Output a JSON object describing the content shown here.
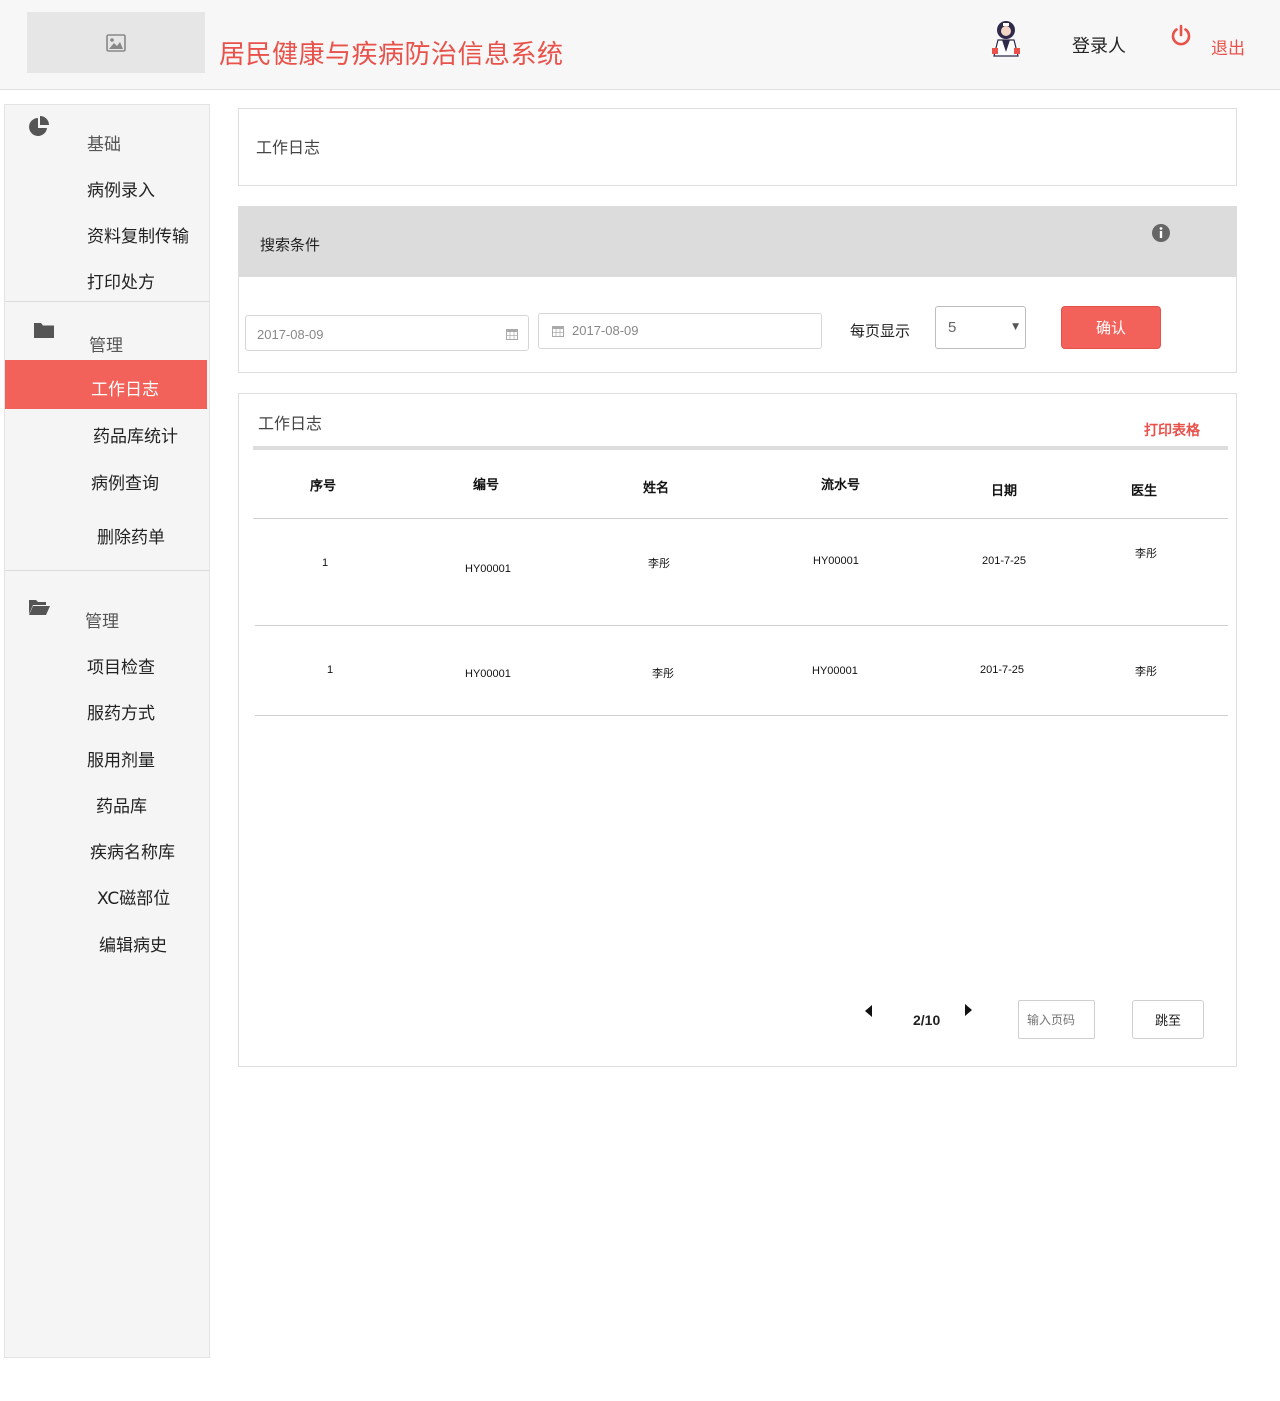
{
  "header": {
    "app_title": "居民健康与疾病防治信息系统",
    "user_label": "登录人",
    "logout_label": "退出",
    "accent_color": "#e8524a"
  },
  "sidebar": {
    "groups": [
      {
        "title": "基础",
        "icon": "pie-chart-icon",
        "items": [
          "病例录入",
          "资料复制传输",
          "打印处方"
        ]
      },
      {
        "title": "管理",
        "icon": "folder-icon",
        "items": [
          "工作日志",
          "药品库统计",
          "病例查询",
          "删除药单"
        ]
      },
      {
        "title": "管理",
        "icon": "folder-open-icon",
        "items": [
          "项目检查",
          "服药方式",
          "服用剂量",
          "药品库",
          "疾病名称库",
          "XC磁部位",
          "编辑病史"
        ]
      }
    ],
    "active_item": "工作日志",
    "active_color": "#f2625a"
  },
  "page_title": "工作日志",
  "search": {
    "title": "搜索条件",
    "start_date": "2017-08-09",
    "end_date": "2017-08-09",
    "per_page_label": "每页显示",
    "per_page_value": "5",
    "confirm_label": "确认"
  },
  "table": {
    "title": "工作日志",
    "print_label": "打印表格",
    "columns": [
      "序号",
      "编号",
      "姓名",
      "流水号",
      "日期",
      "医生"
    ],
    "rows": [
      [
        "1",
        "HY00001",
        "李彤",
        "HY00001",
        "201-7-25",
        "李彤"
      ],
      [
        "1",
        "HY00001",
        "李彤",
        "HY00001",
        "201-7-25",
        "李彤"
      ]
    ]
  },
  "pager": {
    "page_text": "2/10",
    "page_input_placeholder": "输入页码",
    "jump_label": "跳至"
  }
}
